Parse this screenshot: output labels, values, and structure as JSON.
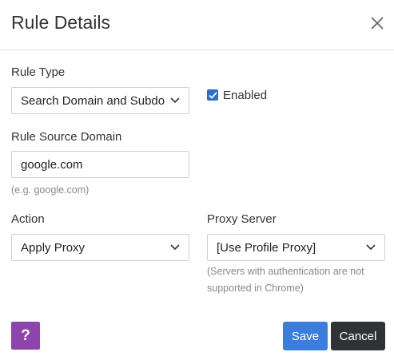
{
  "dialog": {
    "title": "Rule Details",
    "close_icon": "close-icon"
  },
  "form": {
    "rule_type": {
      "label": "Rule Type",
      "value": "Search Domain and Subdomains"
    },
    "enabled": {
      "label": "Enabled",
      "checked": true
    },
    "source_domain": {
      "label": "Rule Source Domain",
      "value": "google.com",
      "hint": "(e.g. google.com)"
    },
    "action": {
      "label": "Action",
      "value": "Apply Proxy"
    },
    "proxy_server": {
      "label": "Proxy Server",
      "value": "[Use Profile Proxy]",
      "hint_line1": "(Servers with authentication are not",
      "hint_line2": "supported in Chrome)"
    }
  },
  "footer": {
    "help_label": "?",
    "save_label": "Save",
    "cancel_label": "Cancel"
  },
  "colors": {
    "help": "#8e44ad",
    "save": "#3b7ddd",
    "cancel": "#303336",
    "checkbox": "#2f6fc8"
  }
}
